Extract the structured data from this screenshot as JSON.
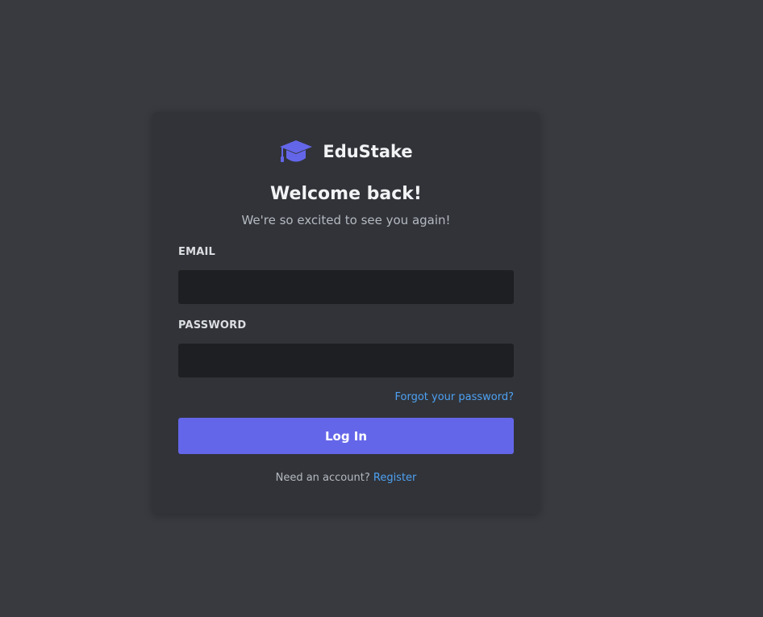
{
  "brand": {
    "name": "EduStake",
    "icon": "graduation-cap-icon",
    "accent_color": "#6466e9"
  },
  "login": {
    "title": "Welcome back!",
    "subtitle": "We're so excited to see you again!",
    "email_label": "EMAIL",
    "email_value": "",
    "password_label": "PASSWORD",
    "password_value": "",
    "forgot_link": "Forgot your password?",
    "submit_label": "Log In",
    "register_prompt": "Need an account?",
    "register_link": "Register",
    "link_color": "#4ea1f3"
  }
}
